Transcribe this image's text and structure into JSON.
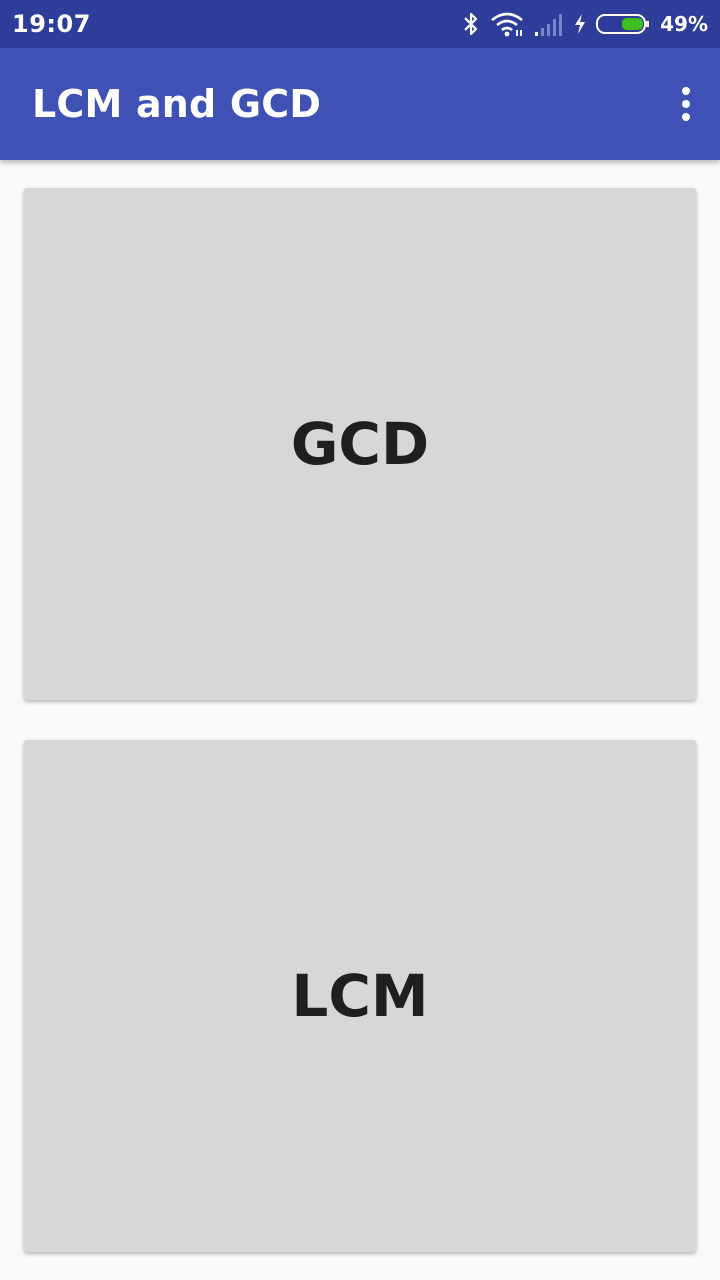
{
  "status_bar": {
    "time": "19:07",
    "battery_percent": "49%",
    "battery_level": 0.49,
    "icons": [
      "bluetooth-icon",
      "wifi-icon",
      "signal-icon",
      "charging-icon",
      "battery-icon"
    ]
  },
  "app_bar": {
    "title": "LCM and GCD",
    "menu_icon": "more-vert-icon"
  },
  "buttons": {
    "gcd_label": "GCD",
    "lcm_label": "LCM"
  },
  "colors": {
    "status_bar": "#2f3d9a",
    "app_bar": "#3f51b5",
    "card": "#d6d7d7",
    "background": "#fafafa",
    "battery_fill": "#3fbf1f"
  }
}
